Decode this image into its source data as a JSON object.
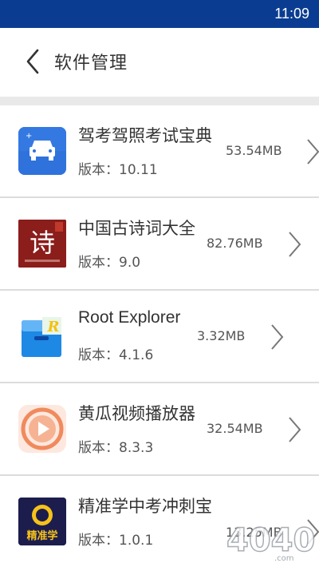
{
  "status_bar": {
    "time": "11:09",
    "bg_color": "#0a3d91"
  },
  "header": {
    "title": "软件管理",
    "back_icon": "chevron-left-icon"
  },
  "apps": [
    {
      "name": "驾考驾照考试宝典",
      "version": "版本：10.11",
      "size": "53.54MB",
      "icon": "car-icon"
    },
    {
      "name": "中国古诗词大全",
      "version": "版本：9.0",
      "size": "82.76MB",
      "icon": "poem-icon",
      "icon_glyph": "诗"
    },
    {
      "name": "Root Explorer",
      "version": "版本：4.1.6",
      "size": "3.32MB",
      "icon": "file-box-icon",
      "icon_glyph": "R"
    },
    {
      "name": "黄瓜视频播放器",
      "version": "版本：8.3.3",
      "size": "32.54MB",
      "icon": "play-icon"
    },
    {
      "name": "精准学中考冲刺宝",
      "version": "版本：1.0.1",
      "size": "13.25MB",
      "icon": "target-icon",
      "icon_glyph": "精准学"
    }
  ],
  "watermark": {
    "text": "4040.com",
    "icon": "watermark-logo"
  }
}
